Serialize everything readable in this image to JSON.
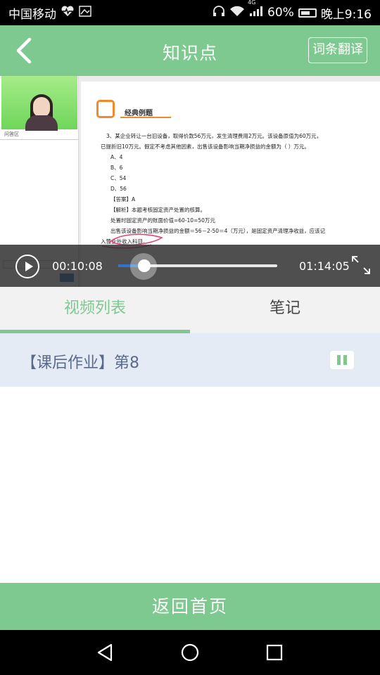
{
  "status_bar": {
    "carrier": "中国移动",
    "network_badge": "4G",
    "battery": "60%",
    "time": "晚上9:16",
    "icons": [
      "heart-monitor-icon",
      "image-icon",
      "headphones-icon",
      "wifi-icon",
      "signal-icon",
      "battery-icon"
    ]
  },
  "header": {
    "title": "知识点",
    "translate_label": "词条翻译",
    "back_icon": "chevron-left-icon"
  },
  "video": {
    "current_time": "00:10:08",
    "total_time": "01:14:05",
    "progress": 0.137,
    "teacher_panel": {
      "qa_label": "问答区"
    },
    "slide": {
      "heading": "经典例题",
      "lines": [
        "3、某企业转让一台旧设备，取得价款56万元，发生清理费用2万元。该设备原值为60万元，",
        "已提折旧10万元。假定不考虑其他因素，出售该设备影响当期净损益的金额为（    ）万元。",
        "A、4",
        "B、6",
        "C、54",
        "D、56",
        "【答案】A",
        "【解析】本题考核固定资产处置的核算。",
        "处置时固定资产的账面价值=60-10=50万元",
        "出售该设备影响当期净损益的金额＝56－2-50＝4（万元），是固定资产清理净收益，应该记",
        "入营业外收入科目。"
      ]
    }
  },
  "tabs": [
    {
      "label": "视频列表",
      "active": true
    },
    {
      "label": "笔记",
      "active": false
    }
  ],
  "list": [
    {
      "title": "【课后作业】第8",
      "state": "playing"
    }
  ],
  "footer": {
    "home_label": "返回首页"
  },
  "colors": {
    "primary": "#7dc98f",
    "list_bg": "#e4ebf5",
    "list_text": "#5a6a8a",
    "seek_fill": "#2f74c8"
  }
}
